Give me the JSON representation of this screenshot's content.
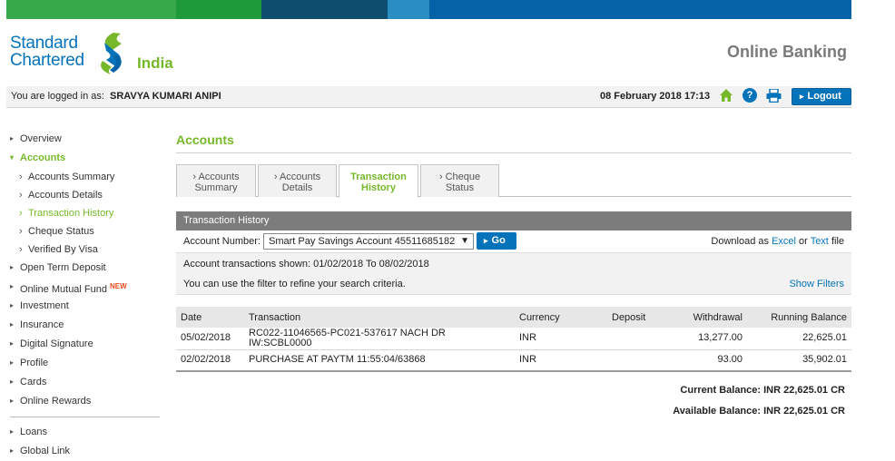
{
  "brand": {
    "name_line1": "Standard",
    "name_line2": "Chartered",
    "country": "India",
    "app_title": "Online Banking",
    "colors": {
      "blue": "#0473ba",
      "green": "#76b82a",
      "bar": [
        "#38a948",
        "#1f9a3b",
        "#0e4d6e",
        "#2a8ec2",
        "#0463a6"
      ]
    }
  },
  "session": {
    "logged_in_label": "You are logged in as:",
    "user_name": "SRAVYA KUMARI ANIPI",
    "datetime": "08 February 2018 17:13",
    "help_label": "?",
    "logout_label": "Logout"
  },
  "sidebar": {
    "items": [
      {
        "label": "Overview"
      },
      {
        "label": "Accounts"
      },
      {
        "label": "Open Term Deposit"
      },
      {
        "label": "Online Mutual Fund",
        "badge": "NEW"
      },
      {
        "label": "Investment"
      },
      {
        "label": "Insurance"
      },
      {
        "label": "Digital Signature"
      },
      {
        "label": "Profile"
      },
      {
        "label": "Cards"
      },
      {
        "label": "Online Rewards"
      }
    ],
    "sub_items": [
      {
        "label": "Accounts Summary"
      },
      {
        "label": "Accounts Details"
      },
      {
        "label": "Transaction History"
      },
      {
        "label": "Cheque Status"
      },
      {
        "label": "Verified By Visa"
      }
    ],
    "bottom_items": [
      {
        "label": "Loans"
      },
      {
        "label": "Global Link"
      }
    ]
  },
  "main": {
    "title": "Accounts",
    "tabs": [
      {
        "line1": "Accounts",
        "line2": "Summary"
      },
      {
        "line1": "Accounts",
        "line2": "Details"
      },
      {
        "line1": "Transaction",
        "line2": "History"
      },
      {
        "line1": "Cheque",
        "line2": "Status"
      }
    ],
    "section_title": "Transaction History",
    "account_label": "Account Number:",
    "account_selected": "Smart Pay Savings Account 45511685182",
    "go_label": "Go",
    "download_prefix": "Download as",
    "download_excel": "Excel",
    "download_or": "or",
    "download_text": "Text",
    "download_suffix": "file",
    "shown_text": "Account transactions shown: 01/02/2018 To 08/02/2018",
    "filter_tip": "You can use the filter to refine your search criteria.",
    "show_filters": "Show Filters"
  },
  "table": {
    "headers": [
      "Date",
      "Transaction",
      "Currency",
      "Deposit",
      "Withdrawal",
      "Running Balance"
    ],
    "rows": [
      {
        "date": "05/02/2018",
        "txn_l1": "RC022-11046565-PC021-537617 NACH DR",
        "txn_l2": "IW:SCBL0000",
        "currency": "INR",
        "deposit": "",
        "withdrawal": "13,277.00",
        "balance": "22,625.01"
      },
      {
        "date": "02/02/2018",
        "txn_l1": "PURCHASE AT PAYTM 11:55:04/63868",
        "txn_l2": "",
        "currency": "INR",
        "deposit": "",
        "withdrawal": "93.00",
        "balance": "35,902.01"
      }
    ]
  },
  "balances": {
    "current": "Current Balance: INR  22,625.01 CR",
    "available": "Available Balance: INR  22,625.01 CR"
  }
}
